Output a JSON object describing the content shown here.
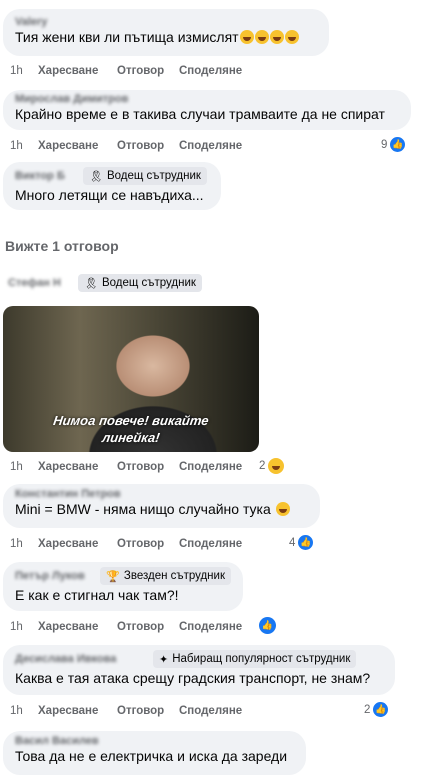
{
  "comments": [
    {
      "author": "Valery",
      "text": "Тия жени кви ли пътища измислят",
      "time": "1h",
      "like": "Харесване",
      "reply": "Отговор",
      "share": "Споделяне",
      "emoji_count": 4
    },
    {
      "author": "Мирослав Димитров",
      "text": "Крайно време е в такива случаи трамваите да не спират",
      "time": "1h",
      "like": "Харесване",
      "reply": "Отговор",
      "share": "Споделяне",
      "reactions": "9"
    },
    {
      "author": "Виктор Б",
      "badge": "Водещ сътрудник",
      "text": "Много летящи се навъдиха...",
      "time": "1h"
    },
    {
      "author": "Стефан Н",
      "badge": "Водещ сътрудник",
      "gif_caption_1": "Нимоа повече! викайте",
      "gif_caption_2": "линейка!",
      "time": "1h",
      "like": "Харесване",
      "reply": "Отговор",
      "share": "Споделяне",
      "reactions": "2"
    },
    {
      "author": "Константин Петров",
      "text": "Mini = BMW - няма нищо случайно тука",
      "time": "1h",
      "like": "Харесване",
      "reply": "Отговор",
      "share": "Споделяне",
      "reactions": "4"
    },
    {
      "author": "Петър Луков",
      "badge": "Звезден сътрудник",
      "text": "Е как е стигнал чак там?!",
      "time": "1h",
      "like": "Харесване",
      "reply": "Отговор",
      "share": "Споделяне"
    },
    {
      "author": "Десислава Ивкова",
      "badge": "Набиращ популярност сътрудник",
      "text": "Каква е тая атака срещу градския транспорт, не знам?",
      "time": "1h",
      "like": "Харесване",
      "reply": "Отговор",
      "share": "Споделяне",
      "reactions": "2"
    },
    {
      "author": "Васил Василев",
      "text": "Това да не е електричка и иска да зареди"
    }
  ],
  "view_replies": "Вижте 1 отговор",
  "icons": {
    "badge_lead": "ribbon-icon",
    "badge_star": "trophy-icon",
    "badge_rising": "sparkle-icon",
    "like": "thumbs-up-icon",
    "haha": "haha-emoji-icon"
  },
  "colors": {
    "bubble": "#f0f2f5",
    "meta": "#65676b",
    "like_blue": "#1877f2"
  }
}
